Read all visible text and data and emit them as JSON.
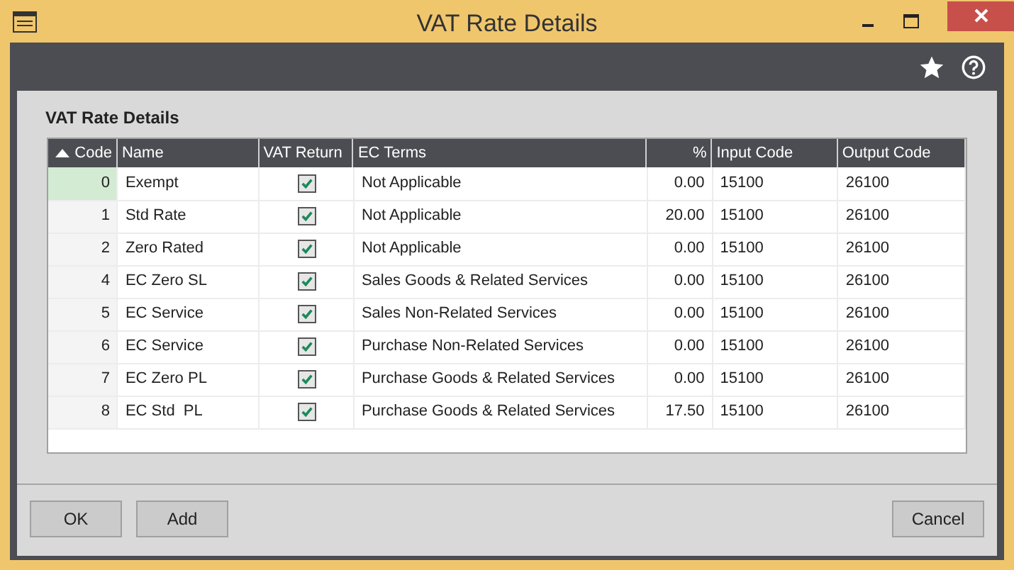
{
  "window": {
    "title": "VAT Rate Details"
  },
  "section_title": "VAT Rate Details",
  "table": {
    "columns": [
      {
        "label": "Code",
        "sorted": true
      },
      {
        "label": "Name",
        "sorted": false
      },
      {
        "label": "VAT Return",
        "sorted": false
      },
      {
        "label": "EC Terms",
        "sorted": false
      },
      {
        "label": "%",
        "sorted": false
      },
      {
        "label": "Input Code",
        "sorted": false
      },
      {
        "label": "Output Code",
        "sorted": false
      }
    ],
    "rows": [
      {
        "selected": true,
        "code": "0",
        "name": "Exempt",
        "vat_return": true,
        "ec_terms": "Not Applicable",
        "percent": "0.00",
        "input_code": "15100",
        "output_code": "26100"
      },
      {
        "selected": false,
        "code": "1",
        "name": "Std Rate",
        "vat_return": true,
        "ec_terms": "Not Applicable",
        "percent": "20.00",
        "input_code": "15100",
        "output_code": "26100"
      },
      {
        "selected": false,
        "code": "2",
        "name": "Zero Rated",
        "vat_return": true,
        "ec_terms": "Not Applicable",
        "percent": "0.00",
        "input_code": "15100",
        "output_code": "26100"
      },
      {
        "selected": false,
        "code": "4",
        "name": "EC Zero SL",
        "vat_return": true,
        "ec_terms": "Sales Goods & Related Services",
        "percent": "0.00",
        "input_code": "15100",
        "output_code": "26100"
      },
      {
        "selected": false,
        "code": "5",
        "name": "EC Service",
        "vat_return": true,
        "ec_terms": "Sales Non-Related Services",
        "percent": "0.00",
        "input_code": "15100",
        "output_code": "26100"
      },
      {
        "selected": false,
        "code": "6",
        "name": "EC Service",
        "vat_return": true,
        "ec_terms": "Purchase Non-Related Services",
        "percent": "0.00",
        "input_code": "15100",
        "output_code": "26100"
      },
      {
        "selected": false,
        "code": "7",
        "name": "EC Zero PL",
        "vat_return": true,
        "ec_terms": "Purchase Goods & Related Services",
        "percent": "0.00",
        "input_code": "15100",
        "output_code": "26100"
      },
      {
        "selected": false,
        "code": "8",
        "name": "EC Std  PL",
        "vat_return": true,
        "ec_terms": "Purchase Goods & Related Services",
        "percent": "17.50",
        "input_code": "15100",
        "output_code": "26100"
      }
    ]
  },
  "buttons_left": [
    "OK",
    "Add"
  ],
  "buttons_right": [
    "Cancel"
  ]
}
